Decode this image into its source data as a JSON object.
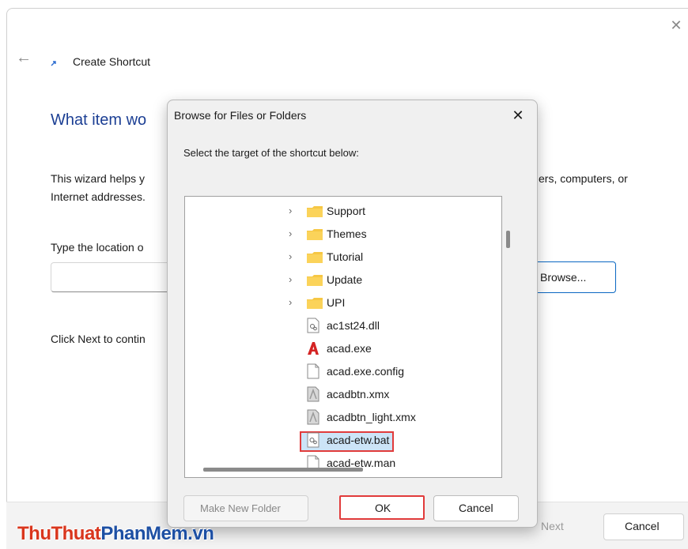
{
  "wizard": {
    "title": "Create Shortcut",
    "heading": "What item wo",
    "desc_line1_left": "This wizard helps y",
    "desc_line1_right": "ers, computers, or",
    "desc_line2": "Internet addresses.",
    "type_label": "Type the location o",
    "input_value": "",
    "browse_label": "Browse...",
    "next_text": "Click Next to contin",
    "next_button": "Next",
    "cancel_button": "Cancel",
    "close_glyph": "✕",
    "back_glyph": "←"
  },
  "dialog": {
    "title": "Browse for Files or Folders",
    "close_glyph": "✕",
    "prompt": "Select the target of the shortcut below:",
    "items": [
      {
        "label": "Support",
        "type": "folder",
        "expandable": true
      },
      {
        "label": "Themes",
        "type": "folder",
        "expandable": true
      },
      {
        "label": "Tutorial",
        "type": "folder",
        "expandable": true
      },
      {
        "label": "Update",
        "type": "folder",
        "expandable": true
      },
      {
        "label": "UPI",
        "type": "folder",
        "expandable": true
      },
      {
        "label": "ac1st24.dll",
        "type": "dll-file-icon"
      },
      {
        "label": "acad.exe",
        "type": "autocad-exe-icon",
        "selected": true
      },
      {
        "label": "acad.exe.config",
        "type": "blank-file-icon"
      },
      {
        "label": "acadbtn.xmx",
        "type": "xmx-file-icon"
      },
      {
        "label": "acadbtn_light.xmx",
        "type": "xmx-file-icon"
      },
      {
        "label": "acad-etw.bat",
        "type": "bat-file-icon"
      },
      {
        "label": "acad-etw.man",
        "type": "blank-file-icon"
      }
    ],
    "new_folder_button": "Make New Folder",
    "ok_button": "OK",
    "cancel_button": "Cancel"
  },
  "watermark": {
    "part1": "ThuThuat",
    "part2": "PhanMem",
    "part3": ".vn"
  },
  "colors": {
    "heading_blue": "#1c3f94",
    "folder_yellow": "#f6c744",
    "highlight_red": "#e13b3b",
    "selection_blue": "#cce4f7",
    "watermark_red": "#d9361d",
    "watermark_blue": "#1d4fa3"
  }
}
